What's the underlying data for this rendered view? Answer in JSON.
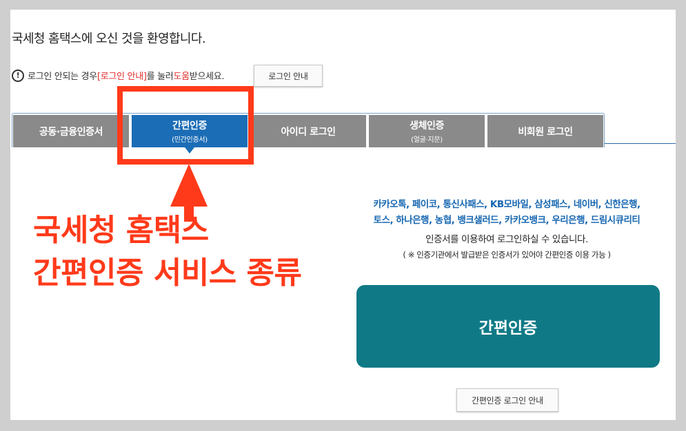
{
  "header": {
    "welcome": "국세청 홈택스에 오신 것을 환영합니다."
  },
  "help": {
    "icon": "exclamation-circle-icon",
    "prefix": "로그인 안되는 경우 ",
    "link_text": "[로그인 안내]",
    "middle": "를 눌러 ",
    "help_word": "도움",
    "suffix": "받으세요.",
    "button_label": "로그인 안내"
  },
  "tabs": [
    {
      "label": "공동·금융인증서",
      "sub": ""
    },
    {
      "label": "간편인증",
      "sub": "(민간인증서)"
    },
    {
      "label": "아이디 로그인",
      "sub": ""
    },
    {
      "label": "생체인증",
      "sub": "(얼굴·지문)"
    },
    {
      "label": "비회원 로그인",
      "sub": ""
    }
  ],
  "annotation": {
    "line1": "국세청 홈택스",
    "line2": "간편인증 서비스 종류"
  },
  "content": {
    "providers_line1": "카카오톡, 페이코, 통신사패스, KB모바일, 삼성패스, 네이버, 신한은행,",
    "providers_line2": "토스, 하나은행, 농협, 뱅크샐러드, 카카오뱅크, 우리은행, 드림시큐리티",
    "usage": "인증서를 이용하여 로그인하실 수 있습니다.",
    "notice": "( ※ 인증기관에서 발급받은 인증서가 있어야 간편인증 이용 가능 )",
    "login_button": "간편인증",
    "guide_button": "간편인증 로그인 안내"
  },
  "colors": {
    "active_tab": "#1b6db6",
    "inactive_tab": "#8a8a8a",
    "provider_text": "#1767b1",
    "login_button": "#0f7a86",
    "annotation": "#ff3a1a"
  }
}
